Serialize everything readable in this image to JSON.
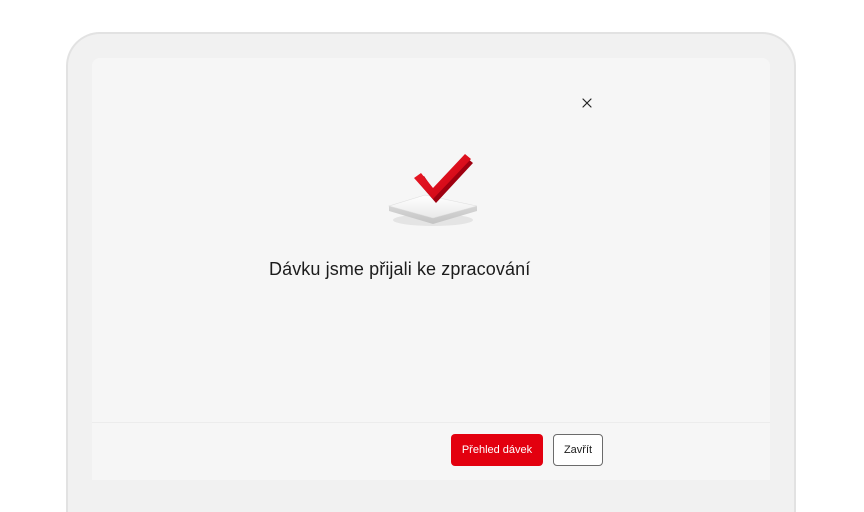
{
  "dialog": {
    "title": "Dávku jsme přijali ke zpracování",
    "close_icon": "close-icon",
    "illustration_icon": "checkmark-on-platform-icon"
  },
  "footer": {
    "primary_label": "Přehled dávek",
    "secondary_label": "Zavřít"
  },
  "colors": {
    "accent": "#e3000f",
    "background": "#f6f6f6",
    "text": "#1c1c1c"
  }
}
